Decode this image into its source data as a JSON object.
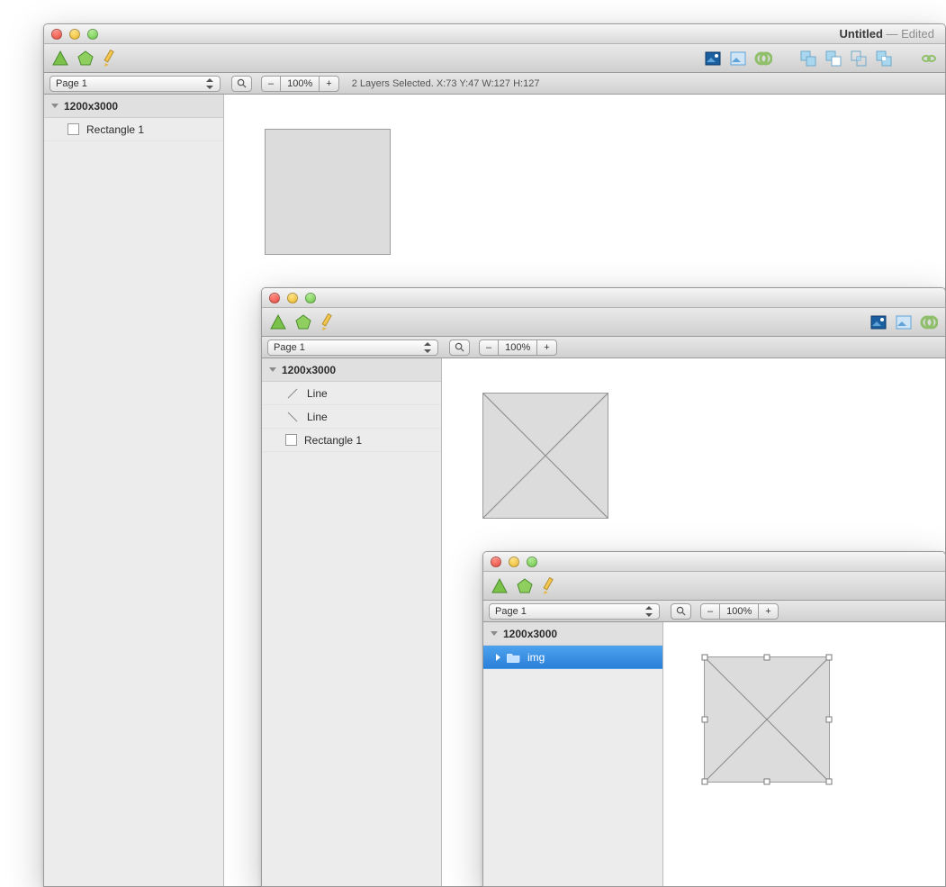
{
  "window1": {
    "title": "Untitled",
    "edited": "— Edited",
    "page": "Page 1",
    "zoom": "100%",
    "status": "2 Layers Selected.  X:73  Y:47  W:127  H:127",
    "artboard": "1200x3000",
    "layers": [
      {
        "name": "Rectangle 1",
        "type": "rect"
      }
    ]
  },
  "window2": {
    "page": "Page 1",
    "zoom": "100%",
    "artboard": "1200x3000",
    "layers": [
      {
        "name": "Line",
        "type": "line"
      },
      {
        "name": "Line",
        "type": "line"
      },
      {
        "name": "Rectangle 1",
        "type": "rect"
      }
    ]
  },
  "window3": {
    "page": "Page 1",
    "zoom": "100%",
    "artboard": "1200x3000",
    "layers": [
      {
        "name": "img",
        "type": "folder",
        "selected": true
      }
    ]
  },
  "labels": {
    "minus": "–",
    "plus": "+"
  }
}
